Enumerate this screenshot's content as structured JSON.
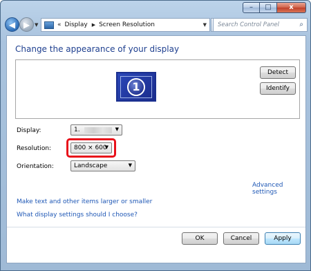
{
  "window": {
    "buttons": {
      "minimize": "–",
      "maximize": "□",
      "close": "x"
    }
  },
  "nav": {
    "back_icon": "arrow-left",
    "forward_icon": "arrow-right",
    "dropdown_icon": "chevron-down"
  },
  "address": {
    "chevron": "«",
    "crumbs": [
      "Display",
      "Screen Resolution"
    ],
    "separator": "▶"
  },
  "search": {
    "placeholder": "Search Control Panel"
  },
  "main": {
    "heading": "Change the appearance of your display",
    "monitor_number": "1",
    "detect_label": "Detect",
    "identify_label": "Identify",
    "display_label": "Display:",
    "display_value": "1.",
    "resolution_label": "Resolution:",
    "resolution_value": "800 × 600",
    "orientation_label": "Orientation:",
    "orientation_value": "Landscape",
    "advanced_link": "Advanced settings",
    "link_larger": "Make text and other items larger or smaller",
    "link_which": "What display settings should I choose?",
    "ok_label": "OK",
    "cancel_label": "Cancel",
    "apply_label": "Apply"
  },
  "colors": {
    "heading": "#1e3f8f",
    "link": "#1e57b5",
    "highlight": "#e8101a"
  }
}
